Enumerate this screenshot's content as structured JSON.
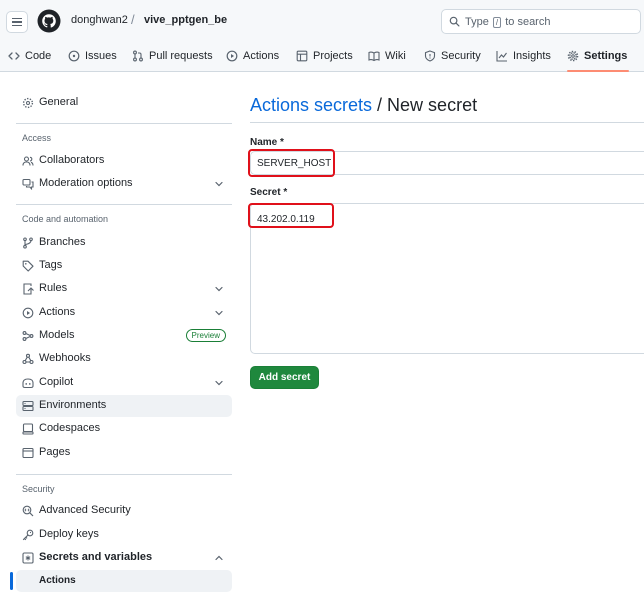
{
  "header": {
    "owner": "donghwan2",
    "separator": "/",
    "repo": "vive_pptgen_be",
    "search": {
      "prefix": "Type",
      "key": "/",
      "suffix": "to search"
    }
  },
  "tabs": [
    {
      "label": "Code",
      "icon": "code-icon"
    },
    {
      "label": "Issues",
      "icon": "issue-icon"
    },
    {
      "label": "Pull requests",
      "icon": "pull-request-icon"
    },
    {
      "label": "Actions",
      "icon": "play-icon"
    },
    {
      "label": "Projects",
      "icon": "table-icon"
    },
    {
      "label": "Wiki",
      "icon": "book-icon"
    },
    {
      "label": "Security",
      "icon": "shield-icon"
    },
    {
      "label": "Insights",
      "icon": "graph-icon"
    },
    {
      "label": "Settings",
      "icon": "gear-icon",
      "selected": true
    }
  ],
  "sidebar": {
    "general": "General",
    "sections": {
      "access": "Access",
      "code_automation": "Code and automation",
      "security": "Security"
    },
    "items": {
      "collaborators": "Collaborators",
      "moderation": "Moderation options",
      "branches": "Branches",
      "tags": "Tags",
      "rules": "Rules",
      "actions": "Actions",
      "models": "Models",
      "models_badge": "Preview",
      "webhooks": "Webhooks",
      "copilot": "Copilot",
      "environments": "Environments",
      "codespaces": "Codespaces",
      "pages": "Pages",
      "advanced_security": "Advanced Security",
      "deploy_keys": "Deploy keys",
      "secrets_variables": "Secrets and variables",
      "sub_actions": "Actions"
    }
  },
  "main": {
    "title_link": "Actions secrets",
    "title_rest": " / New secret",
    "name_label": "Name *",
    "name_value": "SERVER_HOST",
    "secret_label": "Secret *",
    "secret_value": "43.202.0.119",
    "submit_label": "Add secret"
  },
  "colors": {
    "accent": "#0969da",
    "primary_button": "#1f883d",
    "highlight": "#e0101a",
    "tab_underline": "#fd8c73"
  }
}
